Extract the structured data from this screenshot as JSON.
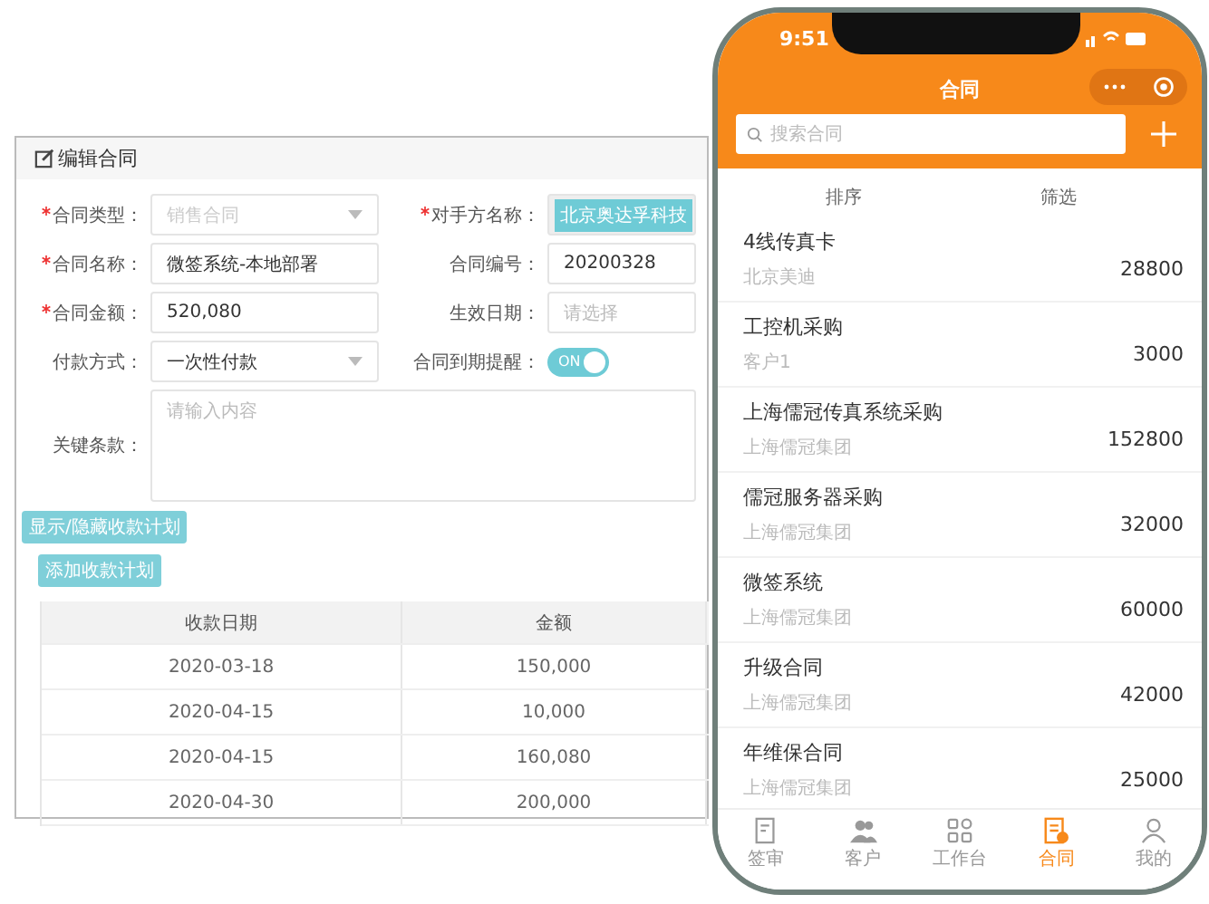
{
  "editor": {
    "title": "编辑合同",
    "fields": [
      {
        "label": "合同类型：",
        "required": true,
        "kind": "select",
        "placeholder": "销售合同"
      },
      {
        "label": "对手方名称：",
        "required": true,
        "kind": "tag",
        "value": "北京奥达孚科技"
      },
      {
        "label": "合同名称：",
        "required": true,
        "kind": "text",
        "value": "微签系统-本地部署"
      },
      {
        "label": "合同编号：",
        "required": false,
        "kind": "text",
        "value": "20200328"
      },
      {
        "label": "合同金额：",
        "required": true,
        "kind": "text",
        "value": "520,080"
      },
      {
        "label": "生效日期：",
        "required": false,
        "kind": "text",
        "placeholder": "请选择"
      },
      {
        "label": "付款方式：",
        "required": false,
        "kind": "select",
        "value": "一次性付款"
      },
      {
        "label": "合同到期提醒：",
        "required": false,
        "kind": "toggle",
        "on": true,
        "value": "ON"
      },
      {
        "label": "关键条款：",
        "required": false,
        "kind": "textarea",
        "placeholder": "请输入内容"
      }
    ],
    "buttons": [
      "显示/隐藏收款计划",
      "添加收款计划"
    ],
    "table": {
      "columns": [
        "收款日期",
        "金额"
      ],
      "rows": [
        [
          "2020-03-18",
          "150,000"
        ],
        [
          "2020-04-15",
          "10,000"
        ],
        [
          "2020-04-15",
          "160,080"
        ],
        [
          "2020-04-30",
          "200,000"
        ]
      ]
    }
  },
  "phone": {
    "time": "9:51",
    "title": "合同",
    "search": {
      "placeholder": "搜索合同"
    },
    "sort": "排序",
    "filter": "筛选",
    "items": [
      {
        "title": "4线传真卡",
        "company": "北京美迪",
        "amount": "28800"
      },
      {
        "title": "工控机采购",
        "company": "客户1",
        "amount": "3000"
      },
      {
        "title": "上海儒冠传真系统采购",
        "company": "上海儒冠集团",
        "amount": "152800"
      },
      {
        "title": "儒冠服务器采购",
        "company": "上海儒冠集团",
        "amount": "32000"
      },
      {
        "title": "微签系统",
        "company": "上海儒冠集团",
        "amount": "60000"
      },
      {
        "title": "升级合同",
        "company": "上海儒冠集团",
        "amount": "42000"
      },
      {
        "title": "年维保合同",
        "company": "上海儒冠集团",
        "amount": "25000"
      }
    ],
    "tabs": [
      {
        "label": "签审",
        "kind": "doc",
        "selected": false
      },
      {
        "label": "客户",
        "kind": "people",
        "selected": false
      },
      {
        "label": "工作台",
        "kind": "grid",
        "selected": false
      },
      {
        "label": "合同",
        "kind": "contract",
        "selected": true
      },
      {
        "label": "我的",
        "kind": "person",
        "selected": false
      }
    ]
  }
}
